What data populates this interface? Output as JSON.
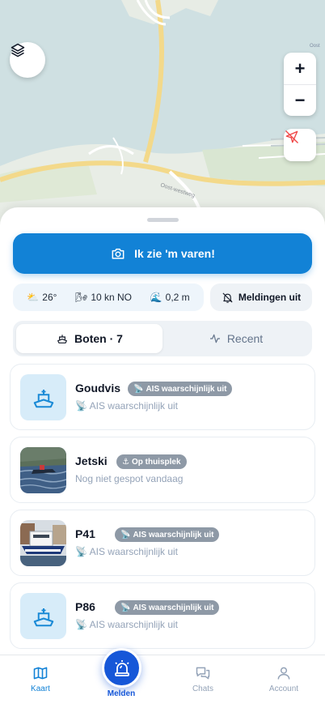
{
  "map": {
    "road_label": "Oost-westweg",
    "corner_label": "Oost",
    "zoom_in": "+",
    "zoom_out": "−",
    "layers_icon": "layers-icon",
    "location_icon": "location-off-icon"
  },
  "cta": {
    "label": "Ik zie 'm varen!",
    "icon": "camera-icon"
  },
  "weather": {
    "temp": "26°",
    "wind": "10 kn NO",
    "waves": "0,2 m",
    "temp_emoji": "⛅",
    "wind_emoji": "🌬",
    "waves_emoji": "🌊"
  },
  "notifications": {
    "label": "Meldingen uit"
  },
  "tabs": [
    {
      "label": "Boten · 7",
      "active": true
    },
    {
      "label": "Recent",
      "active": false
    }
  ],
  "boats": [
    {
      "name": "Goudvis",
      "badge": "AIS waarschijnlijk uit",
      "badge_emoji": "📡",
      "status": "AIS waarschijnlijk uit",
      "status_emoji": "📡",
      "thumb": "ship-icon"
    },
    {
      "name": "Jetski",
      "badge": "Op thuisplek",
      "badge_emoji": "⚓",
      "status": "Nog niet gespot vandaag",
      "status_emoji": "",
      "thumb": "photo"
    },
    {
      "name": "P41",
      "badge": "AIS waarschijnlijk uit",
      "badge_emoji": "📡",
      "status": "AIS waarschijnlijk uit",
      "status_emoji": "📡",
      "thumb": "photo"
    },
    {
      "name": "P86",
      "badge": "AIS waarschijnlijk uit",
      "badge_emoji": "📡",
      "status": "AIS waarschijnlijk uit",
      "status_emoji": "📡",
      "thumb": "ship-icon"
    }
  ],
  "nav": {
    "map": "Kaart",
    "report": "Melden",
    "chats": "Chats",
    "account": "Account"
  },
  "colors": {
    "accent": "#1282d6",
    "fab": "#1657d8",
    "badge": "#8e99a6"
  }
}
